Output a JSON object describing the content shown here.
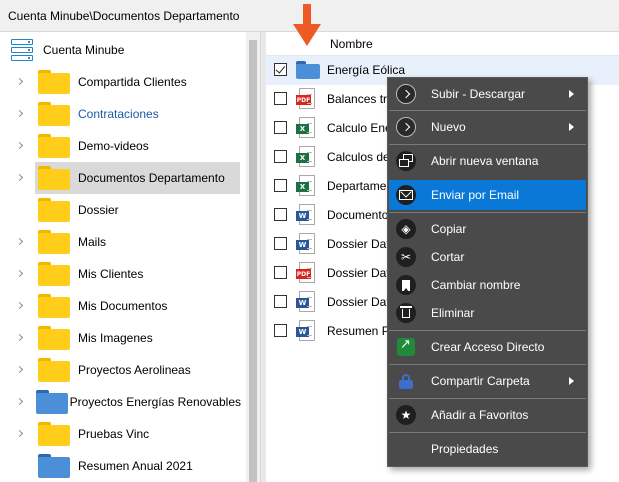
{
  "window": {
    "title": "Cuenta Minube\\Documentos Departamento"
  },
  "tree": {
    "root_label": "Cuenta Minube",
    "items": [
      {
        "label": "Compartida Clientes",
        "color": "yellow",
        "selected": false,
        "link": false
      },
      {
        "label": "Contrataciones",
        "color": "yellow",
        "selected": false,
        "link": true
      },
      {
        "label": "Demo-videos",
        "color": "yellow",
        "selected": false,
        "link": false
      },
      {
        "label": "Documentos Departamento",
        "color": "yellow",
        "selected": true,
        "link": false
      },
      {
        "label": "Dossier",
        "color": "yellow",
        "selected": false,
        "link": false
      },
      {
        "label": "Mails",
        "color": "yellow",
        "selected": false,
        "link": false
      },
      {
        "label": "Mis Clientes",
        "color": "yellow",
        "selected": false,
        "link": false
      },
      {
        "label": "Mis Documentos",
        "color": "yellow",
        "selected": false,
        "link": false
      },
      {
        "label": "Mis Imagenes",
        "color": "yellow",
        "selected": false,
        "link": false
      },
      {
        "label": "Proyectos Aerolineas",
        "color": "yellow",
        "selected": false,
        "link": false
      },
      {
        "label": "Proyectos Energías Renovables",
        "color": "blue",
        "selected": false,
        "link": false
      },
      {
        "label": "Pruebas Vinc",
        "color": "yellow",
        "selected": false,
        "link": false
      },
      {
        "label": "Resumen Anual 2021",
        "color": "blue",
        "selected": false,
        "link": false
      }
    ]
  },
  "list": {
    "column_header": "Nombre",
    "rows": [
      {
        "name": "Energía Eólica",
        "type": "folder",
        "checked": true
      },
      {
        "name": "Balances trá",
        "type": "pdf",
        "checked": false
      },
      {
        "name": "Calculo Ene",
        "type": "xls",
        "checked": false
      },
      {
        "name": "Calculos de",
        "type": "xls",
        "checked": false
      },
      {
        "name": "Departamen",
        "type": "xls",
        "checked": false
      },
      {
        "name": "Documento",
        "type": "doc",
        "checked": false
      },
      {
        "name": "Dossier Data",
        "type": "doc",
        "checked": false
      },
      {
        "name": "Dossier Data",
        "type": "pdf",
        "checked": false
      },
      {
        "name": "Dossier Data",
        "type": "doc",
        "checked": false
      },
      {
        "name": "Resumen Pr",
        "type": "doc",
        "checked": false
      }
    ]
  },
  "context_menu": {
    "items": [
      {
        "label": "Subir - Descargar",
        "icon": "chevron-circle-icon",
        "submenu": true
      },
      {
        "label": "Nuevo",
        "icon": "chevron-circle-icon",
        "submenu": true
      },
      {
        "label": "Abrir nueva ventana",
        "icon": "new-window-icon",
        "submenu": false
      },
      {
        "label": "Enviar por Email",
        "icon": "envelope-icon",
        "submenu": false,
        "active": true
      },
      {
        "label": "Copiar",
        "icon": "layers-icon",
        "submenu": false
      },
      {
        "label": "Cortar",
        "icon": "scissors-icon",
        "submenu": false
      },
      {
        "label": "Cambiar nombre",
        "icon": "bookmark-icon",
        "submenu": false
      },
      {
        "label": "Eliminar",
        "icon": "trash-icon",
        "submenu": false
      },
      {
        "label": "Crear Acceso Directo",
        "icon": "shortcut-icon",
        "submenu": false
      },
      {
        "label": "Compartir Carpeta",
        "icon": "lock-icon",
        "submenu": true
      },
      {
        "label": "Añadir a Favoritos",
        "icon": "star-icon",
        "submenu": false
      },
      {
        "label": "Propiedades",
        "icon": "",
        "submenu": false
      }
    ]
  },
  "colors": {
    "accent": "#0a78d7",
    "menu_bg": "#4a4a4a",
    "arrow": "#ee5a24",
    "folder_yellow": "#ffcd1a",
    "folder_blue": "#4a8fd8"
  }
}
